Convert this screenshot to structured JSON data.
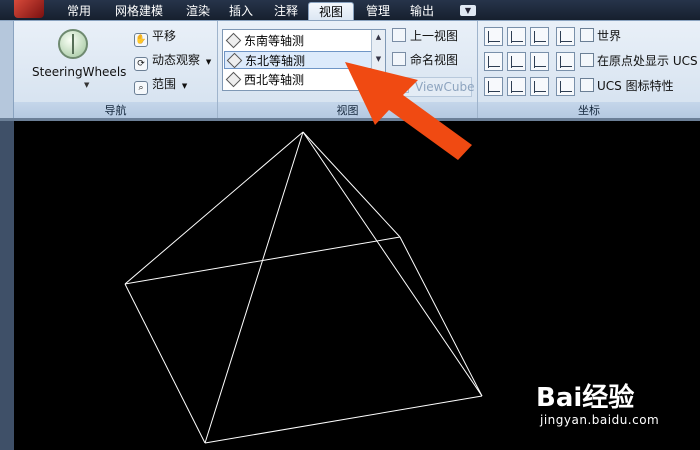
{
  "tabs": [
    {
      "label": "常用"
    },
    {
      "label": "网格建模"
    },
    {
      "label": "渲染"
    },
    {
      "label": "插入"
    },
    {
      "label": "注释"
    },
    {
      "label": "视图"
    },
    {
      "label": "管理"
    },
    {
      "label": "输出"
    }
  ],
  "active_tab": "视图",
  "ribbon": {
    "navigation": {
      "title": "导航",
      "steering_wheels": "SteeringWheels",
      "pan": "平移",
      "orbit": "动态观察",
      "extents": "范围"
    },
    "views": {
      "title": "视图",
      "list": [
        {
          "label": "东南等轴测"
        },
        {
          "label": "东北等轴测"
        },
        {
          "label": "西北等轴测"
        }
      ],
      "selected": "东北等轴测",
      "previous_view": "上一视图",
      "named_views": "命名视图",
      "viewcube": "ViewCube"
    },
    "coordinates": {
      "title": "坐标",
      "world": "世界",
      "show_at_origin": "在原点处显示 UCS",
      "ucs_properties": "UCS 图标特性"
    }
  },
  "annotation_color": "#f04a12",
  "watermark": {
    "brand": "Bai经验",
    "url": "jingyan.baidu.com"
  }
}
